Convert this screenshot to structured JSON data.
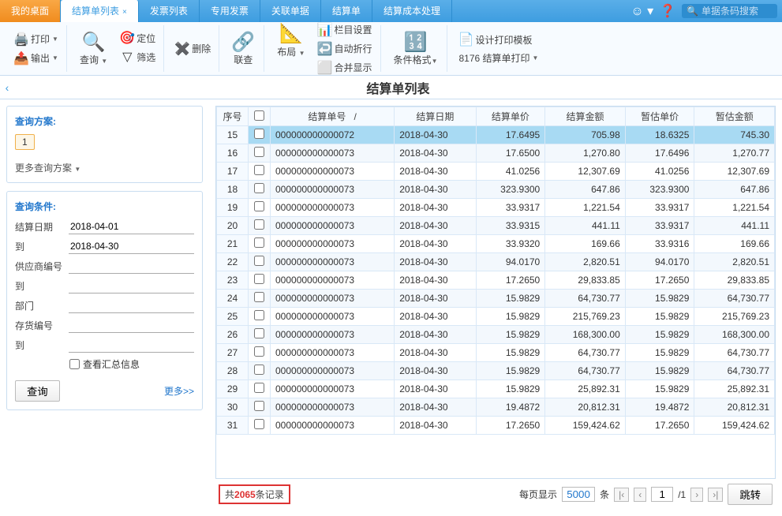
{
  "tabs": {
    "desktop": "我的桌面",
    "active": "结算单列表",
    "t2": "发票列表",
    "t3": "专用发票",
    "t4": "关联单据",
    "t5": "结算单",
    "t6": "结算成本处理"
  },
  "search_placeholder": "单据条码搜索",
  "ribbon": {
    "print": "打印",
    "output": "输出",
    "query": "查询",
    "locate": "定位",
    "filter": "筛选",
    "delete": "删除",
    "link": "联查",
    "layout": "布局",
    "colset": "栏目设置",
    "autowrap": "自动折行",
    "merge": "合并显示",
    "condfmt": "条件格式",
    "tplset": "设计打印模板",
    "tplprint": "8176 结算单打印"
  },
  "page_title": "结算单列表",
  "query_scheme": {
    "title": "查询方案:",
    "num": "1",
    "more": "更多查询方案"
  },
  "query_cond": {
    "title": "查询条件:",
    "date_label": "结算日期",
    "date_from": "2018-04-01",
    "to_label": "到",
    "date_to": "2018-04-30",
    "supplier_label": "供应商编号",
    "supplier_to_label": "到",
    "dept_label": "部门",
    "inv_label": "存货编号",
    "inv_to_label": "到",
    "view_summary": "查看汇总信息",
    "query_btn": "查询",
    "more_link": "更多>>"
  },
  "table": {
    "headers": {
      "seq": "序号",
      "docno": "结算单号",
      "date": "结算日期",
      "price": "结算单价",
      "amount": "结算金额",
      "est_price": "暂估单价",
      "est_amount": "暂估金额"
    },
    "rows": [
      {
        "seq": "15",
        "docno": "000000000000072",
        "date": "2018-04-30",
        "price": "17.6495",
        "amount": "705.98",
        "est_price": "18.6325",
        "est_amount": "745.30",
        "sel": true
      },
      {
        "seq": "16",
        "docno": "000000000000073",
        "date": "2018-04-30",
        "price": "17.6500",
        "amount": "1,270.80",
        "est_price": "17.6496",
        "est_amount": "1,270.77"
      },
      {
        "seq": "17",
        "docno": "000000000000073",
        "date": "2018-04-30",
        "price": "41.0256",
        "amount": "12,307.69",
        "est_price": "41.0256",
        "est_amount": "12,307.69"
      },
      {
        "seq": "18",
        "docno": "000000000000073",
        "date": "2018-04-30",
        "price": "323.9300",
        "amount": "647.86",
        "est_price": "323.9300",
        "est_amount": "647.86"
      },
      {
        "seq": "19",
        "docno": "000000000000073",
        "date": "2018-04-30",
        "price": "33.9317",
        "amount": "1,221.54",
        "est_price": "33.9317",
        "est_amount": "1,221.54"
      },
      {
        "seq": "20",
        "docno": "000000000000073",
        "date": "2018-04-30",
        "price": "33.9315",
        "amount": "441.11",
        "est_price": "33.9317",
        "est_amount": "441.11"
      },
      {
        "seq": "21",
        "docno": "000000000000073",
        "date": "2018-04-30",
        "price": "33.9320",
        "amount": "169.66",
        "est_price": "33.9316",
        "est_amount": "169.66"
      },
      {
        "seq": "22",
        "docno": "000000000000073",
        "date": "2018-04-30",
        "price": "94.0170",
        "amount": "2,820.51",
        "est_price": "94.0170",
        "est_amount": "2,820.51"
      },
      {
        "seq": "23",
        "docno": "000000000000073",
        "date": "2018-04-30",
        "price": "17.2650",
        "amount": "29,833.85",
        "est_price": "17.2650",
        "est_amount": "29,833.85"
      },
      {
        "seq": "24",
        "docno": "000000000000073",
        "date": "2018-04-30",
        "price": "15.9829",
        "amount": "64,730.77",
        "est_price": "15.9829",
        "est_amount": "64,730.77"
      },
      {
        "seq": "25",
        "docno": "000000000000073",
        "date": "2018-04-30",
        "price": "15.9829",
        "amount": "215,769.23",
        "est_price": "15.9829",
        "est_amount": "215,769.23"
      },
      {
        "seq": "26",
        "docno": "000000000000073",
        "date": "2018-04-30",
        "price": "15.9829",
        "amount": "168,300.00",
        "est_price": "15.9829",
        "est_amount": "168,300.00"
      },
      {
        "seq": "27",
        "docno": "000000000000073",
        "date": "2018-04-30",
        "price": "15.9829",
        "amount": "64,730.77",
        "est_price": "15.9829",
        "est_amount": "64,730.77"
      },
      {
        "seq": "28",
        "docno": "000000000000073",
        "date": "2018-04-30",
        "price": "15.9829",
        "amount": "64,730.77",
        "est_price": "15.9829",
        "est_amount": "64,730.77"
      },
      {
        "seq": "29",
        "docno": "000000000000073",
        "date": "2018-04-30",
        "price": "15.9829",
        "amount": "25,892.31",
        "est_price": "15.9829",
        "est_amount": "25,892.31"
      },
      {
        "seq": "30",
        "docno": "000000000000073",
        "date": "2018-04-30",
        "price": "19.4872",
        "amount": "20,812.31",
        "est_price": "19.4872",
        "est_amount": "20,812.31"
      },
      {
        "seq": "31",
        "docno": "000000000000073",
        "date": "2018-04-30",
        "price": "17.2650",
        "amount": "159,424.62",
        "est_price": "17.2650",
        "est_amount": "159,424.62"
      }
    ]
  },
  "footer": {
    "total_prefix": "共",
    "total_count": "2065",
    "total_suffix": "条记录",
    "per_page_label": "每页显示",
    "per_page_value": "5000",
    "unit": "条",
    "cur_page": "1",
    "total_pages": "/1",
    "jump": "跳转"
  }
}
